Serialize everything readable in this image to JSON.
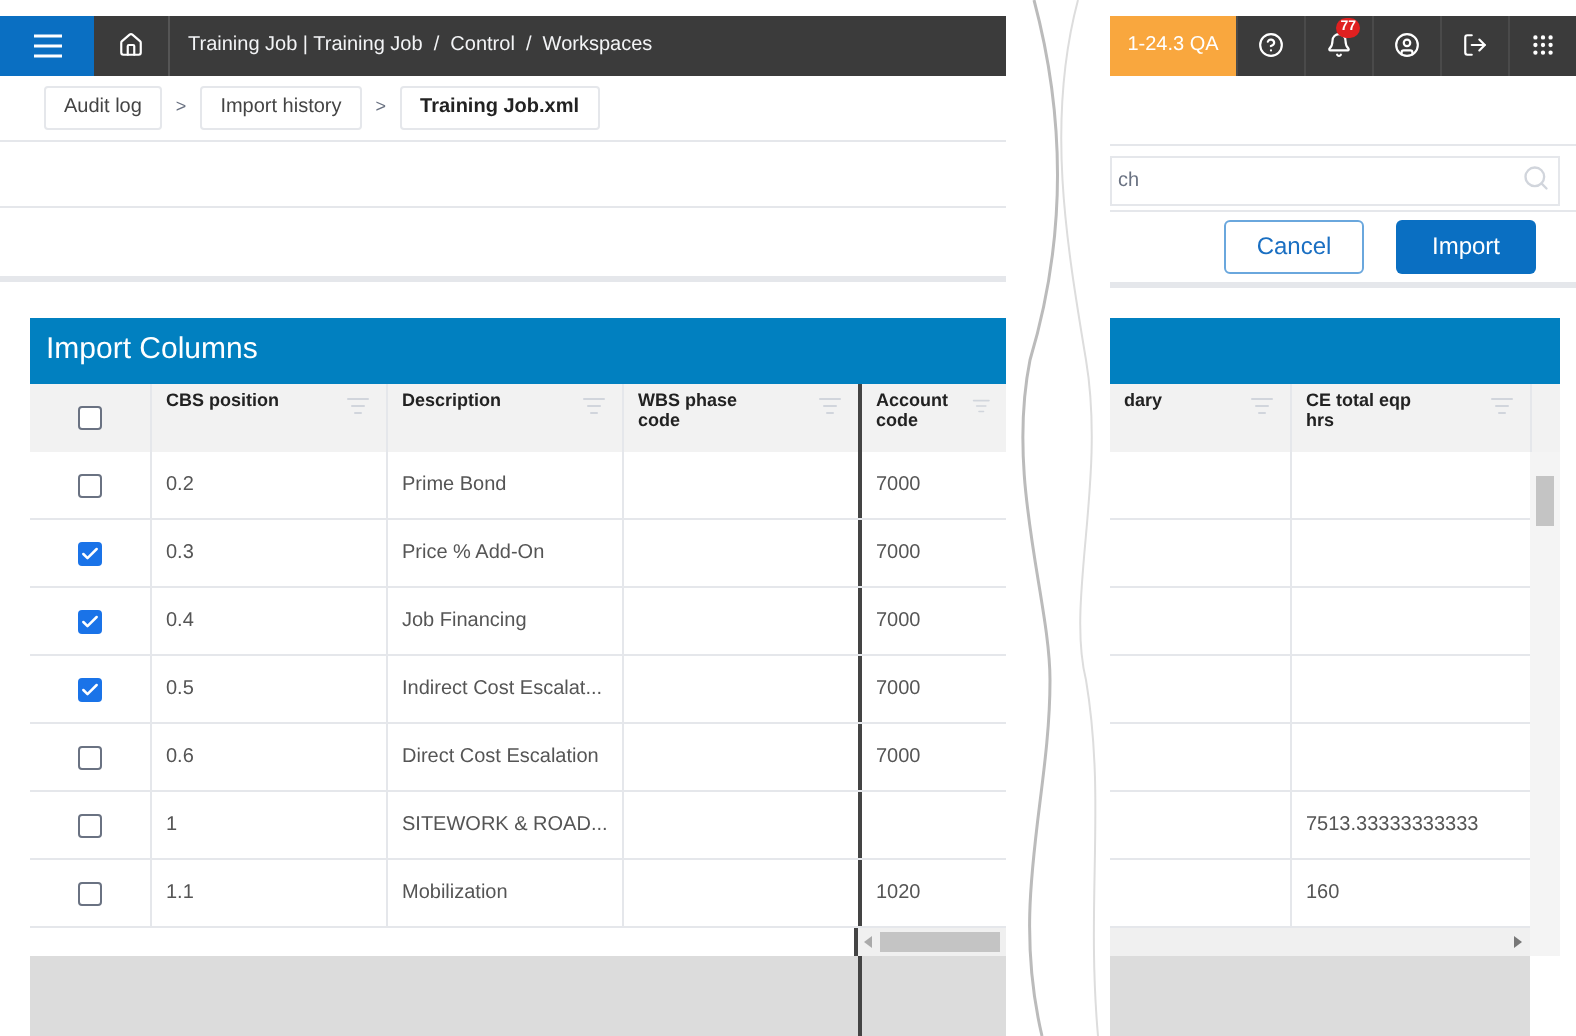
{
  "topbar": {
    "breadcrumb": "Training Job | Training Job  /  Control  /  Workspaces",
    "environment": "1-24.3 QA",
    "notifications": "77"
  },
  "breadcrumbs": [
    {
      "label": "Audit log",
      "selected": false
    },
    {
      "label": "Import history",
      "selected": false
    },
    {
      "label": "Training Job.xml",
      "selected": true
    }
  ],
  "breadcrumb_separator": ">",
  "search": {
    "placeholder": "ch"
  },
  "buttons": [
    {
      "label": "Cancel",
      "kind": "secondary"
    },
    {
      "label": "Import",
      "kind": "primary"
    }
  ],
  "panel": {
    "title": "Import Columns"
  },
  "table": {
    "select_all_checked": false,
    "columns": [
      "CBS position",
      "Description",
      "WBS phase code",
      "Account code",
      "dary",
      "CE total eqp hrs"
    ],
    "rows": [
      {
        "checked": false,
        "cells": [
          "0.2",
          "Prime Bond",
          "",
          "7000",
          "",
          ""
        ]
      },
      {
        "checked": true,
        "cells": [
          "0.3",
          "Price % Add-On",
          "",
          "7000",
          "",
          ""
        ]
      },
      {
        "checked": true,
        "cells": [
          "0.4",
          "Job Financing",
          "",
          "7000",
          "",
          ""
        ]
      },
      {
        "checked": true,
        "cells": [
          "0.5",
          "Indirect Cost Escalat...",
          "",
          "7000",
          "",
          ""
        ]
      },
      {
        "checked": false,
        "cells": [
          "0.6",
          "Direct Cost Escalation",
          "",
          "7000",
          "",
          ""
        ]
      },
      {
        "checked": false,
        "cells": [
          "1",
          "SITEWORK & ROAD...",
          "",
          "",
          "",
          "7513.33333333333"
        ]
      },
      {
        "checked": false,
        "cells": [
          "1.1",
          "Mobilization",
          "",
          "1020",
          "",
          "160"
        ]
      }
    ]
  }
}
